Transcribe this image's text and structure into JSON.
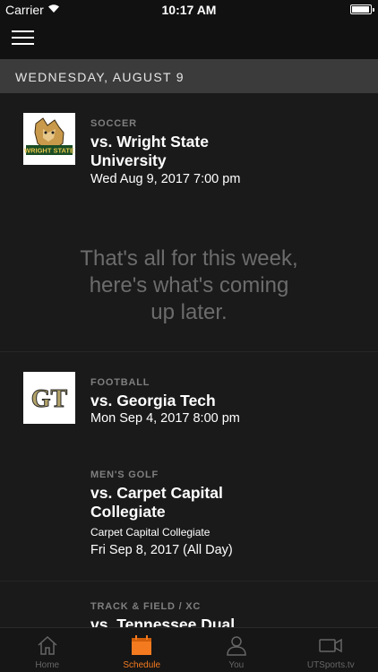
{
  "status": {
    "carrier": "Carrier",
    "time": "10:17 AM"
  },
  "section": {
    "date": "WEDNESDAY, AUGUST 9"
  },
  "message": {
    "line1": "That's all for this week,",
    "line2": "here's what's coming",
    "line3": "up later."
  },
  "events": [
    {
      "sport": "SOCCER",
      "title_line1": "vs. Wright State",
      "title_line2": "University",
      "date": "Wed Aug 9, 2017 7:00 pm",
      "logo": "wright-state-logo",
      "logo_text": "WRIGHT STATE"
    },
    {
      "sport": "FOOTBALL",
      "title_line1": "vs. Georgia Tech",
      "date": "Mon Sep 4, 2017 8:00 pm",
      "logo": "georgia-tech-logo",
      "logo_text": "GT"
    },
    {
      "sport": "MEN'S GOLF",
      "title_line1": "vs. Carpet Capital",
      "title_line2": "Collegiate",
      "venue": "Carpet Capital Collegiate",
      "date": "Fri Sep 8, 2017 (All Day)"
    },
    {
      "sport": "TRACK & FIELD / XC",
      "title_line1": "vs. Tennessee Dual"
    }
  ],
  "tabs": [
    {
      "label": "Home",
      "icon": "home-icon"
    },
    {
      "label": "Schedule",
      "icon": "calendar-icon",
      "active": true
    },
    {
      "label": "You",
      "icon": "person-icon"
    },
    {
      "label": "UTSports.tv",
      "icon": "video-camera-icon"
    }
  ],
  "colors": {
    "accent": "#f47a1f",
    "background": "#1a1a1a",
    "header": "#3b3b3b",
    "secondary_text": "#7f7f7f"
  }
}
